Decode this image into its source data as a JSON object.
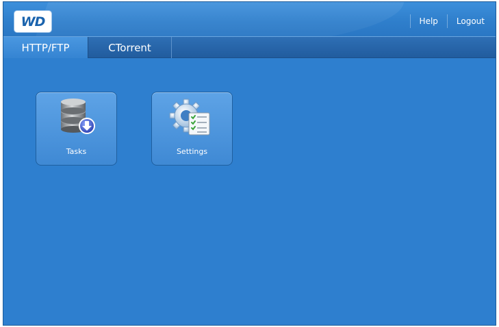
{
  "header": {
    "logo_text": "WD",
    "links": {
      "help": "Help",
      "logout": "Logout"
    }
  },
  "tabs": [
    {
      "label": "HTTP/FTP",
      "active": true
    },
    {
      "label": "CTorrent",
      "active": false
    }
  ],
  "tiles": [
    {
      "label": "Tasks",
      "icon": "database-download-icon"
    },
    {
      "label": "Settings",
      "icon": "gear-checklist-icon"
    }
  ],
  "colors": {
    "background": "#2e7fcf",
    "tab_active": "#3b8ad6",
    "tab_bar": "#2565a8"
  }
}
